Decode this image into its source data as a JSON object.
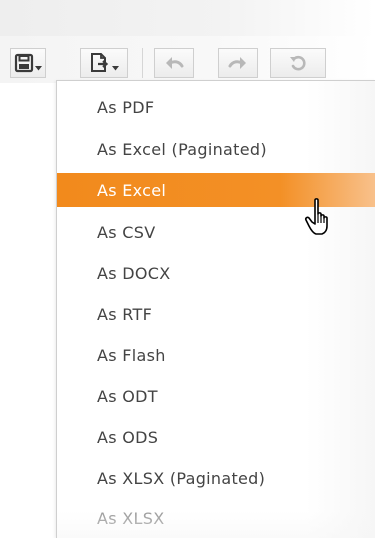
{
  "toolbar": {
    "buttons": [
      {
        "name": "save-button",
        "icon": "floppy-disk-icon"
      },
      {
        "name": "export-button",
        "icon": "document-export-icon"
      },
      {
        "name": "undo-button",
        "icon": "undo-arrow-icon"
      },
      {
        "name": "redo-button",
        "icon": "redo-arrow-icon"
      },
      {
        "name": "reset-button",
        "icon": "reset-icon"
      }
    ]
  },
  "menu": {
    "items": [
      {
        "label": "As PDF"
      },
      {
        "label": "As Excel (Paginated)"
      },
      {
        "label": "As Excel",
        "selected": true
      },
      {
        "label": "As CSV"
      },
      {
        "label": "As DOCX"
      },
      {
        "label": "As RTF"
      },
      {
        "label": "As Flash"
      },
      {
        "label": "As ODT"
      },
      {
        "label": "As ODS"
      },
      {
        "label": "As XLSX (Paginated)"
      },
      {
        "label": "As XLSX"
      }
    ]
  },
  "colors": {
    "selected_bg": "#f28a1c",
    "selected_text": "#ffffff",
    "item_text": "#444444",
    "icon_dark": "#3a3a3a",
    "icon_disabled": "#b8b8b8"
  }
}
